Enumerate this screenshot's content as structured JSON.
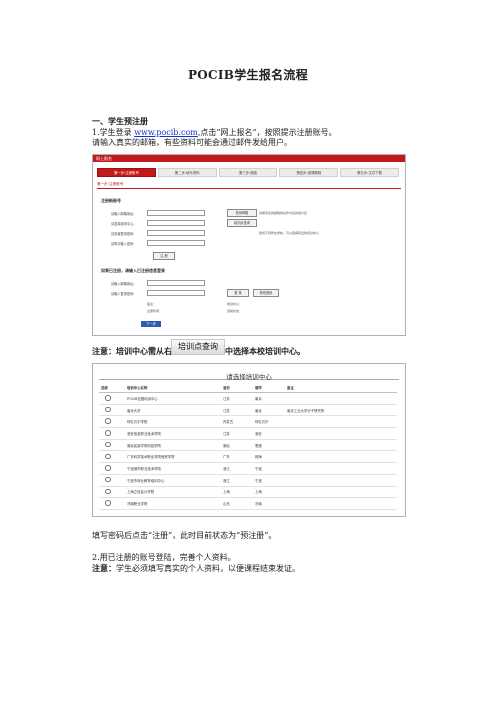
{
  "doc": {
    "title": "POCIB学生报名流程",
    "section1": "一、学生预注册",
    "step1_prefix": "1.学生登录 ",
    "step1_link": "www.pocib.com",
    "step1_suffix": ",点击“网上报名”，按照提示注册账号。",
    "step1_line2": "请输入真实的邮箱，有些资料可能会通过邮件发给用户。",
    "note1_a": "注意：培训中心需从右边",
    "note1_btn": "培训点查询",
    "note1_b": "中选择本校培训中心。",
    "para3": "填写密码后点击“注册”，此时目前状态为“预注册”。",
    "para4": "2.用已注册的账号登陆，完善个人资料。",
    "note2_label": "注意：",
    "note2_text": "学生必须填写真实的个人资料，以便课程结束发证。"
  },
  "screenshot1": {
    "header": "网上报名",
    "steps": [
      "第一步:注册账号",
      "第二步:填写资料",
      "第三步:缴费",
      "第四步:选课题程",
      "第五步:生存下载"
    ],
    "subtitle": "第一步:注册账号",
    "section_new": "注册新账号",
    "new_fields": [
      "请输入邮箱地址：",
      "请选择培训中心：",
      "请设置登录密码：",
      "请再次输入密码："
    ],
    "btn_check": "检测邮箱",
    "btn_query": "培训点查询",
    "btn_register": "注 册",
    "hint1": "请填写您的邮箱地址作为您的用户名",
    "hint2": "如找不到所在学校，可以选择就近的培训中心",
    "section_login": "如果已注册，请输入已注册信息登录",
    "login_fields": [
      "请输入邮箱地址：",
      "请输入登录密码："
    ],
    "btn_login": "登 录",
    "btn_change": "修改密码",
    "status_labels": [
      "备注：",
      "注册时间："
    ],
    "status_values": [
      "培训中心：",
      "目前状态："
    ],
    "btn_next": "下一步"
  },
  "screenshot2": {
    "title": "请选择培训中心",
    "columns": [
      "选择",
      "培训中心名称",
      "省份",
      "城市",
      "备注"
    ],
    "rows": [
      [
        "POCIB全国培训中心",
        "江苏",
        "南京",
        ""
      ],
      [
        "南京大学",
        "江苏",
        "南京",
        "南京工业大学分子研究所"
      ],
      [
        "呼伦贝尔学院",
        "内蒙古",
        "呼伦贝尔",
        ""
      ],
      [
        "淮安信息职业技术学院",
        "江苏",
        "淮安",
        ""
      ],
      [
        "湖北民族学院科技学院",
        "湖北",
        "恩施",
        ""
      ],
      [
        "广东科学技术职业学院商贸学院",
        "广东",
        "珠海",
        ""
      ],
      [
        "宁波城市职业技术学院",
        "浙江",
        "宁波",
        ""
      ],
      [
        "宁波市商业教育培训中心",
        "浙江",
        "宁波",
        ""
      ],
      [
        "上海立信会计学院",
        "上海",
        "上海",
        ""
      ],
      [
        "济南职业学院",
        "山东",
        "济南",
        ""
      ]
    ]
  }
}
